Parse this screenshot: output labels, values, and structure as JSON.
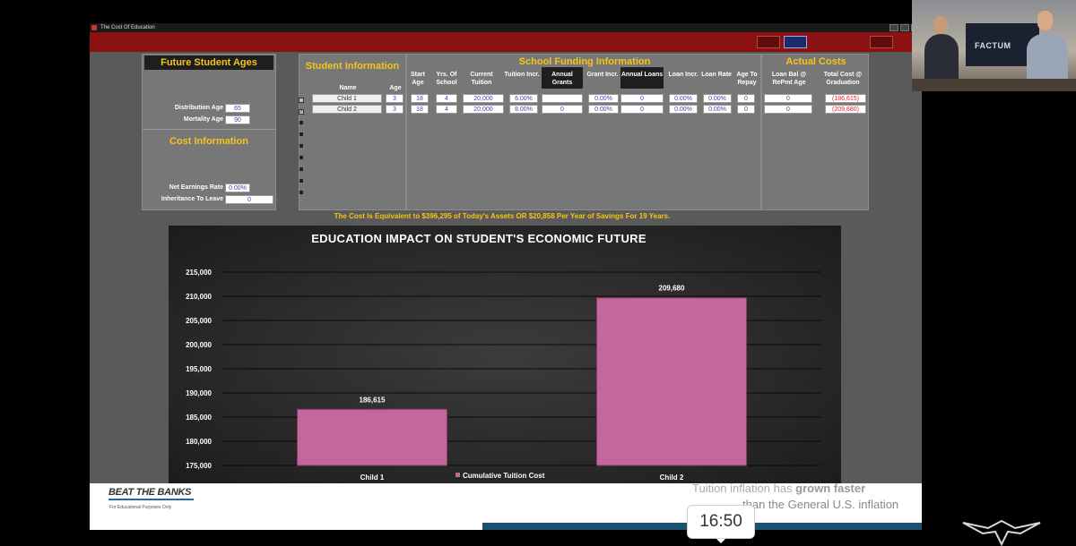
{
  "window": {
    "title": "The Cost Of Education"
  },
  "future_student_ages": {
    "title": "Future Student Ages",
    "distribution_age_label": "Distribution Age",
    "distribution_age": "65",
    "mortality_age_label": "Mortality Age",
    "mortality_age": "90"
  },
  "cost_information": {
    "title": "Cost Information",
    "net_earnings_rate_label": "Net Earnings Rate",
    "net_earnings_rate": "0.00%",
    "inheritance_label": "Inheritance To Leave",
    "inheritance": "0"
  },
  "student_information": {
    "title": "Student Information",
    "headers": {
      "name": "Name",
      "age": "Age"
    }
  },
  "school_funding": {
    "title": "School Funding Information",
    "headers": [
      "Start Age",
      "Yrs. Of School",
      "Current Tuition",
      "Tuition Incr.",
      "Annual Grants",
      "Grant Incr.",
      "Annual Loans",
      "Loan Incr.",
      "Loan Rate",
      "Age To Repay"
    ]
  },
  "actual_costs": {
    "title": "Actual Costs",
    "headers": [
      "Loan Bal @ RePmt Age",
      "Total Cost @ Graduation"
    ]
  },
  "rows": [
    {
      "name": "Child 1",
      "age": "3",
      "start_age": "18",
      "yrs": "4",
      "tuition": "20,000",
      "tuition_incr": "6.00%",
      "grants": "",
      "grant_incr": "0.00%",
      "loans": "0",
      "loan_incr": "0.00%",
      "loan_rate": "0.00%",
      "repay_age": "0",
      "loan_bal": "0",
      "total_cost": "(186,615)"
    },
    {
      "name": "Child 2",
      "age": "3",
      "start_age": "18",
      "yrs": "4",
      "tuition": "20,000",
      "tuition_incr": "8.00%",
      "grants": "0",
      "grant_incr": "0.00%",
      "loans": "0",
      "loan_incr": "0.00%",
      "loan_rate": "0.00%",
      "repay_age": "0",
      "loan_bal": "0",
      "total_cost": "(209,680)"
    }
  ],
  "summary": "The Cost Is Equivalent to $396,295 of Today's Assets OR $20,858 Per Year of Savings For 19 Years.",
  "chart_data": {
    "type": "bar",
    "title": "EDUCATION IMPACT ON STUDENT'S ECONOMIC FUTURE",
    "categories": [
      "Child 1",
      "Child 2"
    ],
    "series": [
      {
        "name": "Cumulative Tuition Cost",
        "values": [
          186615,
          209680
        ]
      }
    ],
    "data_labels": [
      "186,615",
      "209,680"
    ],
    "y_ticks": [
      "175,000",
      "180,000",
      "185,000",
      "190,000",
      "195,000",
      "200,000",
      "205,000",
      "210,000",
      "215,000"
    ],
    "ylim": [
      175000,
      215000
    ],
    "grid": true,
    "legend": "bottom",
    "bar_color": "#c2689a"
  },
  "slide": {
    "brand": "BEAT THE BANKS",
    "disclaimer": "For Educational Purposes Only",
    "line1_a": "Tuition inflation has",
    "line1_b": "grown faster",
    "line2": "than the General U.S. inflation"
  },
  "webcam": {
    "brand": "FACTUM"
  },
  "timer": "16:50"
}
